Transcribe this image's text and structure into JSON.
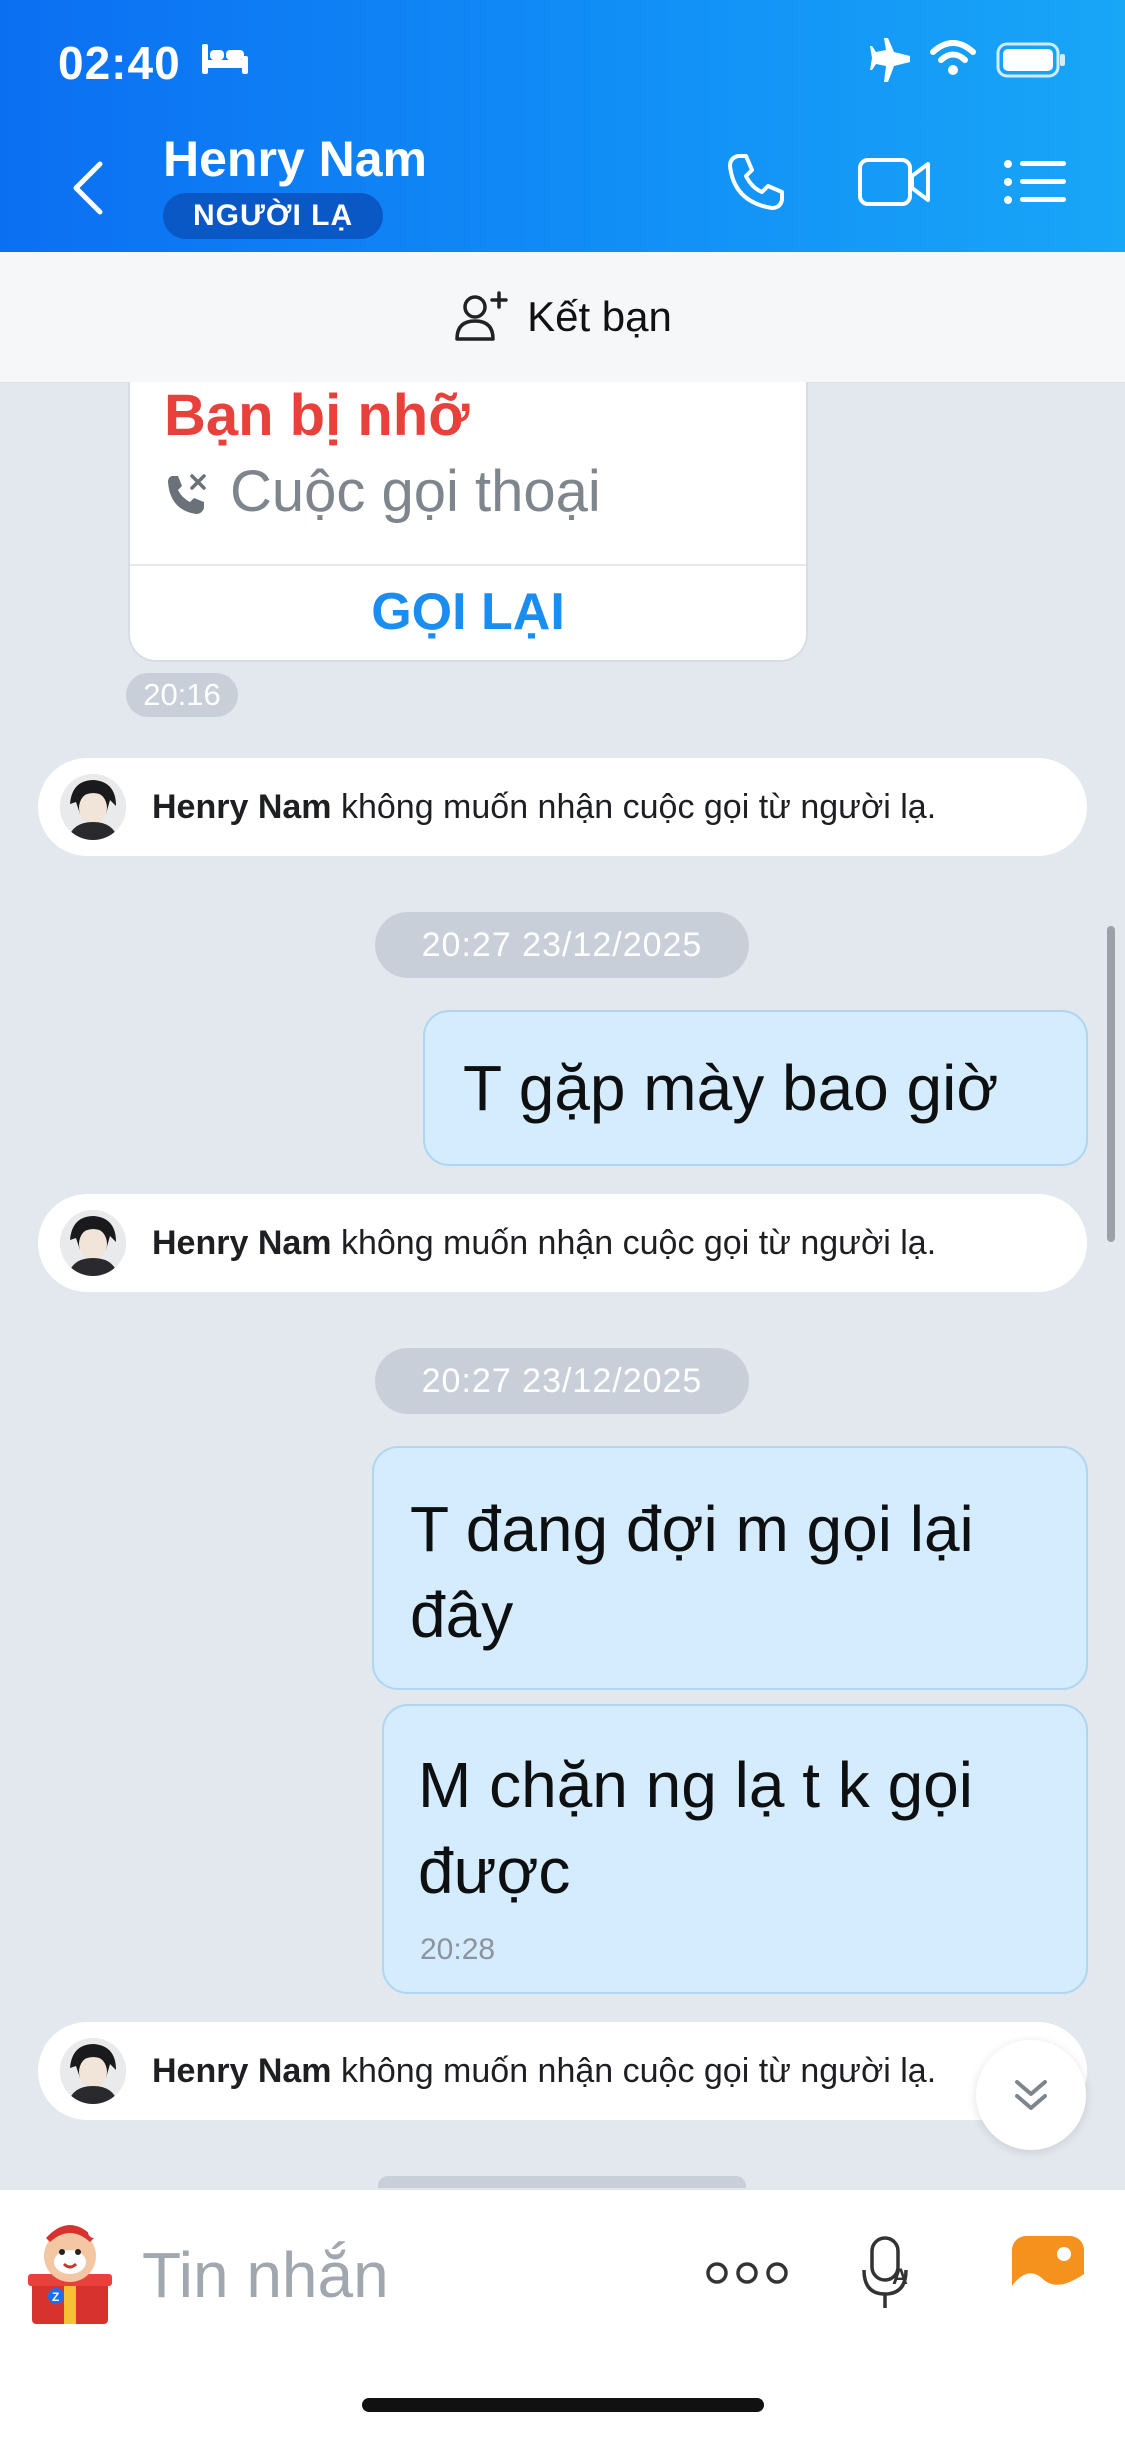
{
  "status_bar": {
    "time": "02:40"
  },
  "header": {
    "contact_name": "Henry Nam",
    "badge": "NGƯỜI LẠ"
  },
  "add_friend": {
    "label": "Kết bạn"
  },
  "call_card": {
    "title": "Bạn bị nhỡ",
    "call_type": "Cuộc gọi thoại",
    "action": "GỌI LẠI",
    "time": "20:16"
  },
  "notices": [
    {
      "name": "Henry Nam",
      "text": "không muốn nhận cuộc gọi từ người lạ."
    },
    {
      "name": "Henry Nam",
      "text": "không muốn nhận cuộc gọi từ người lạ."
    },
    {
      "name": "Henry Nam",
      "text": "không muốn nhận cuộc gọi từ người lạ."
    }
  ],
  "date_separators": [
    "20:27 23/12/2025",
    "20:27 23/12/2025"
  ],
  "messages": [
    {
      "text": "T gặp mày bao giờ"
    },
    {
      "text": "T đang đợi m gọi lại đây"
    },
    {
      "text": "M chặn ng lạ t k gọi được",
      "time": "20:28"
    }
  ],
  "composer": {
    "placeholder": "Tin nhắn"
  },
  "colors": {
    "header_start": "#0b6ff2",
    "header_end": "#18a6f7",
    "missed": "#e8413b",
    "link": "#1a8df0",
    "bubble": "#d4ecfd"
  }
}
